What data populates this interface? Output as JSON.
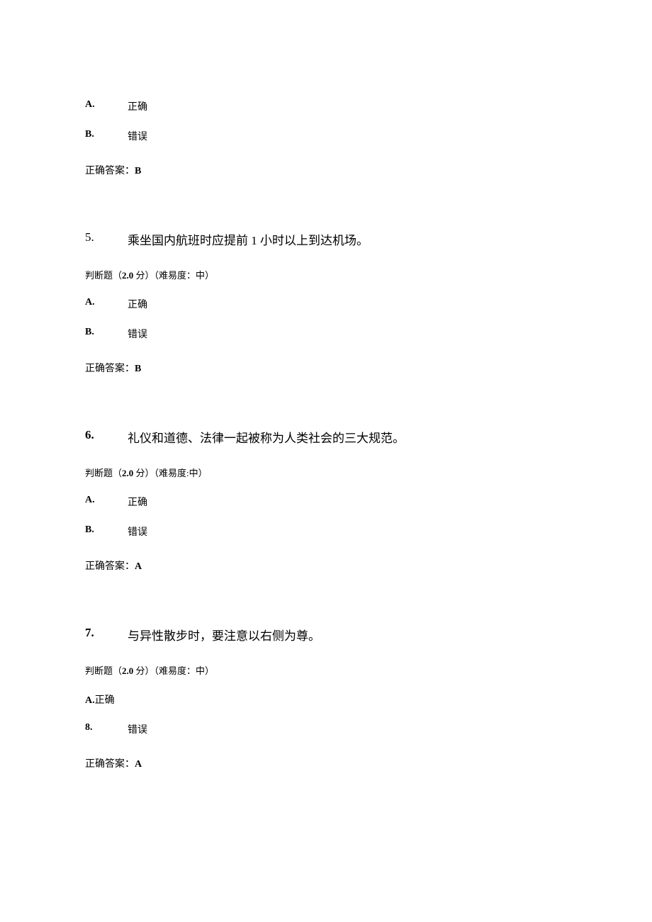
{
  "q4_partial": {
    "optionA_label": "A.",
    "optionA_text": "正确",
    "optionB_label": "B.",
    "optionB_text": "错误",
    "answer_label": "正确答案：",
    "answer_value": "B"
  },
  "q5": {
    "number": "5.",
    "text": "乘坐国内航班时应提前 1 小时以上到达机场。",
    "meta_prefix": "判断题（",
    "meta_score": "2.0",
    "meta_mid": " 分）（难易度：中）",
    "optionA_label": "A.",
    "optionA_text": "正确",
    "optionB_label": "B.",
    "optionB_text": "错误",
    "answer_label": "正确答案：",
    "answer_value": "B"
  },
  "q6": {
    "number": "6.",
    "text": "礼仪和道德、法律一起被称为人类社会的三大规范。",
    "meta_prefix": "判断题（",
    "meta_score": "2.0",
    "meta_mid": " 分）（难易度:中）",
    "optionA_label": "A.",
    "optionA_text": "正确",
    "optionB_label": "B.",
    "optionB_text": "错误",
    "answer_label": "正确答案：",
    "answer_value": "A"
  },
  "q7": {
    "number": "7.",
    "text": "与异性散步时，要注意以右侧为尊。",
    "meta_prefix": "判断题（",
    "meta_score": "2.0",
    "meta_mid": " 分）（难易度：中）",
    "optionA_label": "A.",
    "optionA_text": "正确",
    "optionB_label": "8.",
    "optionB_text": "错误",
    "answer_label": "正确答案：",
    "answer_value": "A"
  }
}
